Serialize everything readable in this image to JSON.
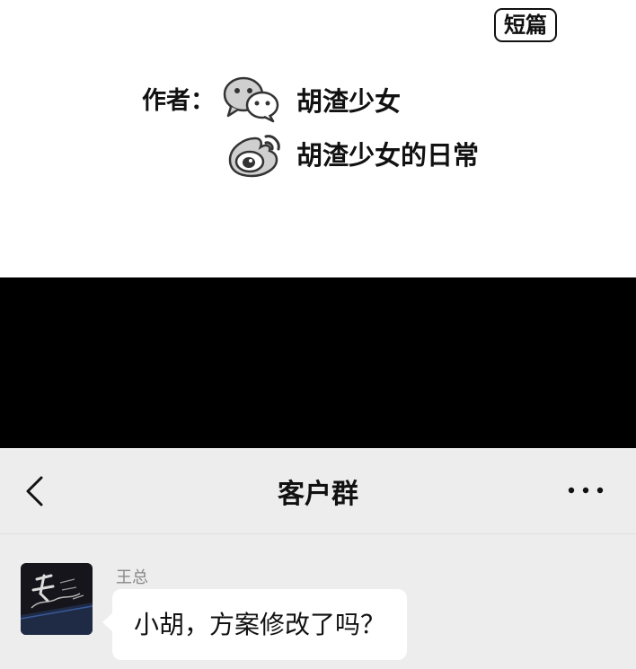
{
  "credits": {
    "tag": "短篇",
    "author_label": "作者：",
    "wechat_account": "胡渣少女",
    "weibo_account": "胡渣少女的日常"
  },
  "chat": {
    "title": "客户群",
    "back_icon": "chevron-left-icon",
    "more_icon": "more-dots-icon",
    "messages": [
      {
        "sender": "王总",
        "text": "小胡，方案修改了吗？"
      }
    ]
  },
  "colors": {
    "chat_bg": "#ededed",
    "bubble_bg": "#ffffff",
    "band": "#000000"
  }
}
